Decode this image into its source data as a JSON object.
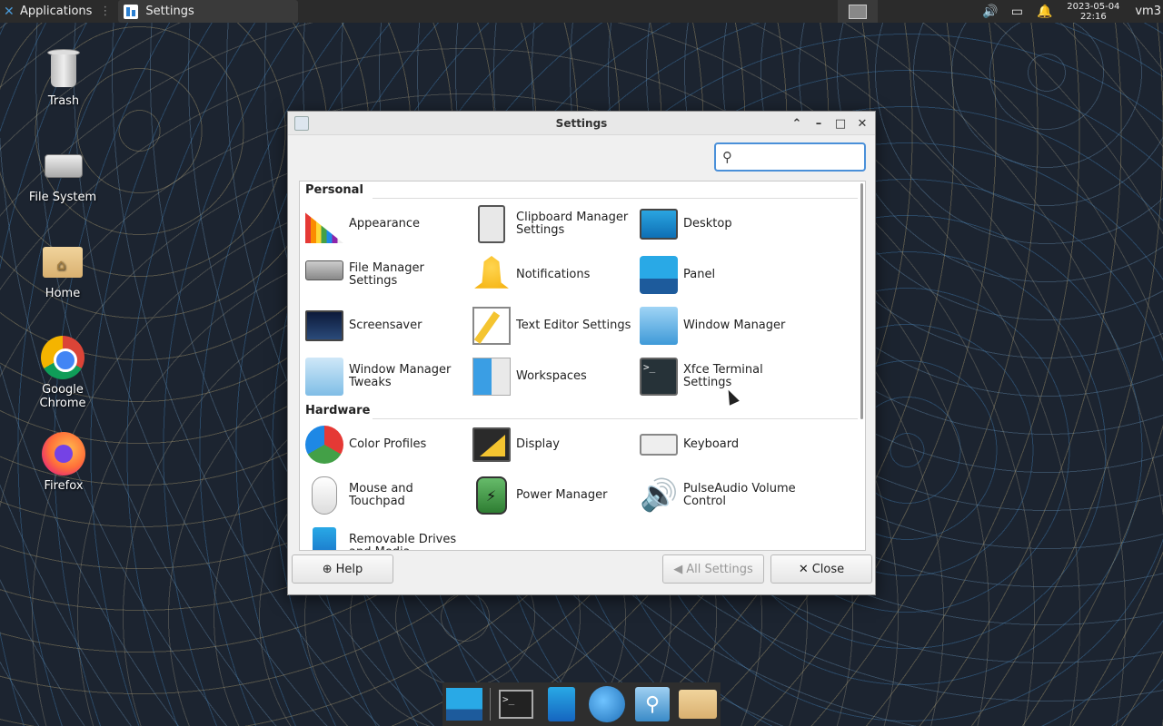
{
  "top_panel": {
    "applications_label": "Applications",
    "active_window_label": "Settings",
    "clock_date": "2023-05-04",
    "clock_time": "22:16",
    "user": "vm3",
    "tray_icons": [
      "volume-icon",
      "battery-icon",
      "notification-bell-icon"
    ]
  },
  "desktop": {
    "icons": [
      {
        "label": "Trash",
        "icon": "trash-icon"
      },
      {
        "label": "File System",
        "icon": "drive-icon"
      },
      {
        "label": "Home",
        "icon": "home-folder-icon"
      },
      {
        "label": "Google Chrome",
        "icon": "chrome-icon"
      },
      {
        "label": "Firefox",
        "icon": "firefox-icon"
      }
    ]
  },
  "window": {
    "title": "Settings",
    "search": {
      "value": "",
      "placeholder": ""
    },
    "sections": [
      {
        "title": "Personal",
        "items": [
          {
            "label": "Appearance",
            "icon": "appearance-icon"
          },
          {
            "label": "Clipboard Manager Settings",
            "icon": "clipboard-icon"
          },
          {
            "label": "Desktop",
            "icon": "desktop-icon"
          },
          {
            "label": "File Manager Settings",
            "icon": "file-manager-icon"
          },
          {
            "label": "Notifications",
            "icon": "bell-icon"
          },
          {
            "label": "Panel",
            "icon": "panel-icon"
          },
          {
            "label": "Screensaver",
            "icon": "screensaver-icon"
          },
          {
            "label": "Text Editor Settings",
            "icon": "text-editor-icon"
          },
          {
            "label": "Window Manager",
            "icon": "window-manager-icon"
          },
          {
            "label": "Window Manager Tweaks",
            "icon": "window-manager-tweaks-icon"
          },
          {
            "label": "Workspaces",
            "icon": "workspaces-icon"
          },
          {
            "label": "Xfce Terminal Settings",
            "icon": "terminal-icon"
          }
        ]
      },
      {
        "title": "Hardware",
        "items": [
          {
            "label": "Color Profiles",
            "icon": "color-profiles-icon"
          },
          {
            "label": "Display",
            "icon": "display-icon"
          },
          {
            "label": "Keyboard",
            "icon": "keyboard-icon"
          },
          {
            "label": "Mouse and Touchpad",
            "icon": "mouse-icon"
          },
          {
            "label": "Power Manager",
            "icon": "battery-power-icon"
          },
          {
            "label": "PulseAudio Volume Control",
            "icon": "speaker-icon"
          },
          {
            "label": "Removable Drives and Media",
            "icon": "usb-drive-icon"
          }
        ]
      }
    ],
    "buttons": {
      "help": "Help",
      "all_settings": "All Settings",
      "close": "Close"
    }
  },
  "dock": {
    "items": [
      "show-desktop-icon",
      "terminal-icon",
      "file-manager-icon",
      "web-browser-icon",
      "app-finder-icon",
      "folder-icon"
    ],
    "terminal_prompt": ">_"
  }
}
